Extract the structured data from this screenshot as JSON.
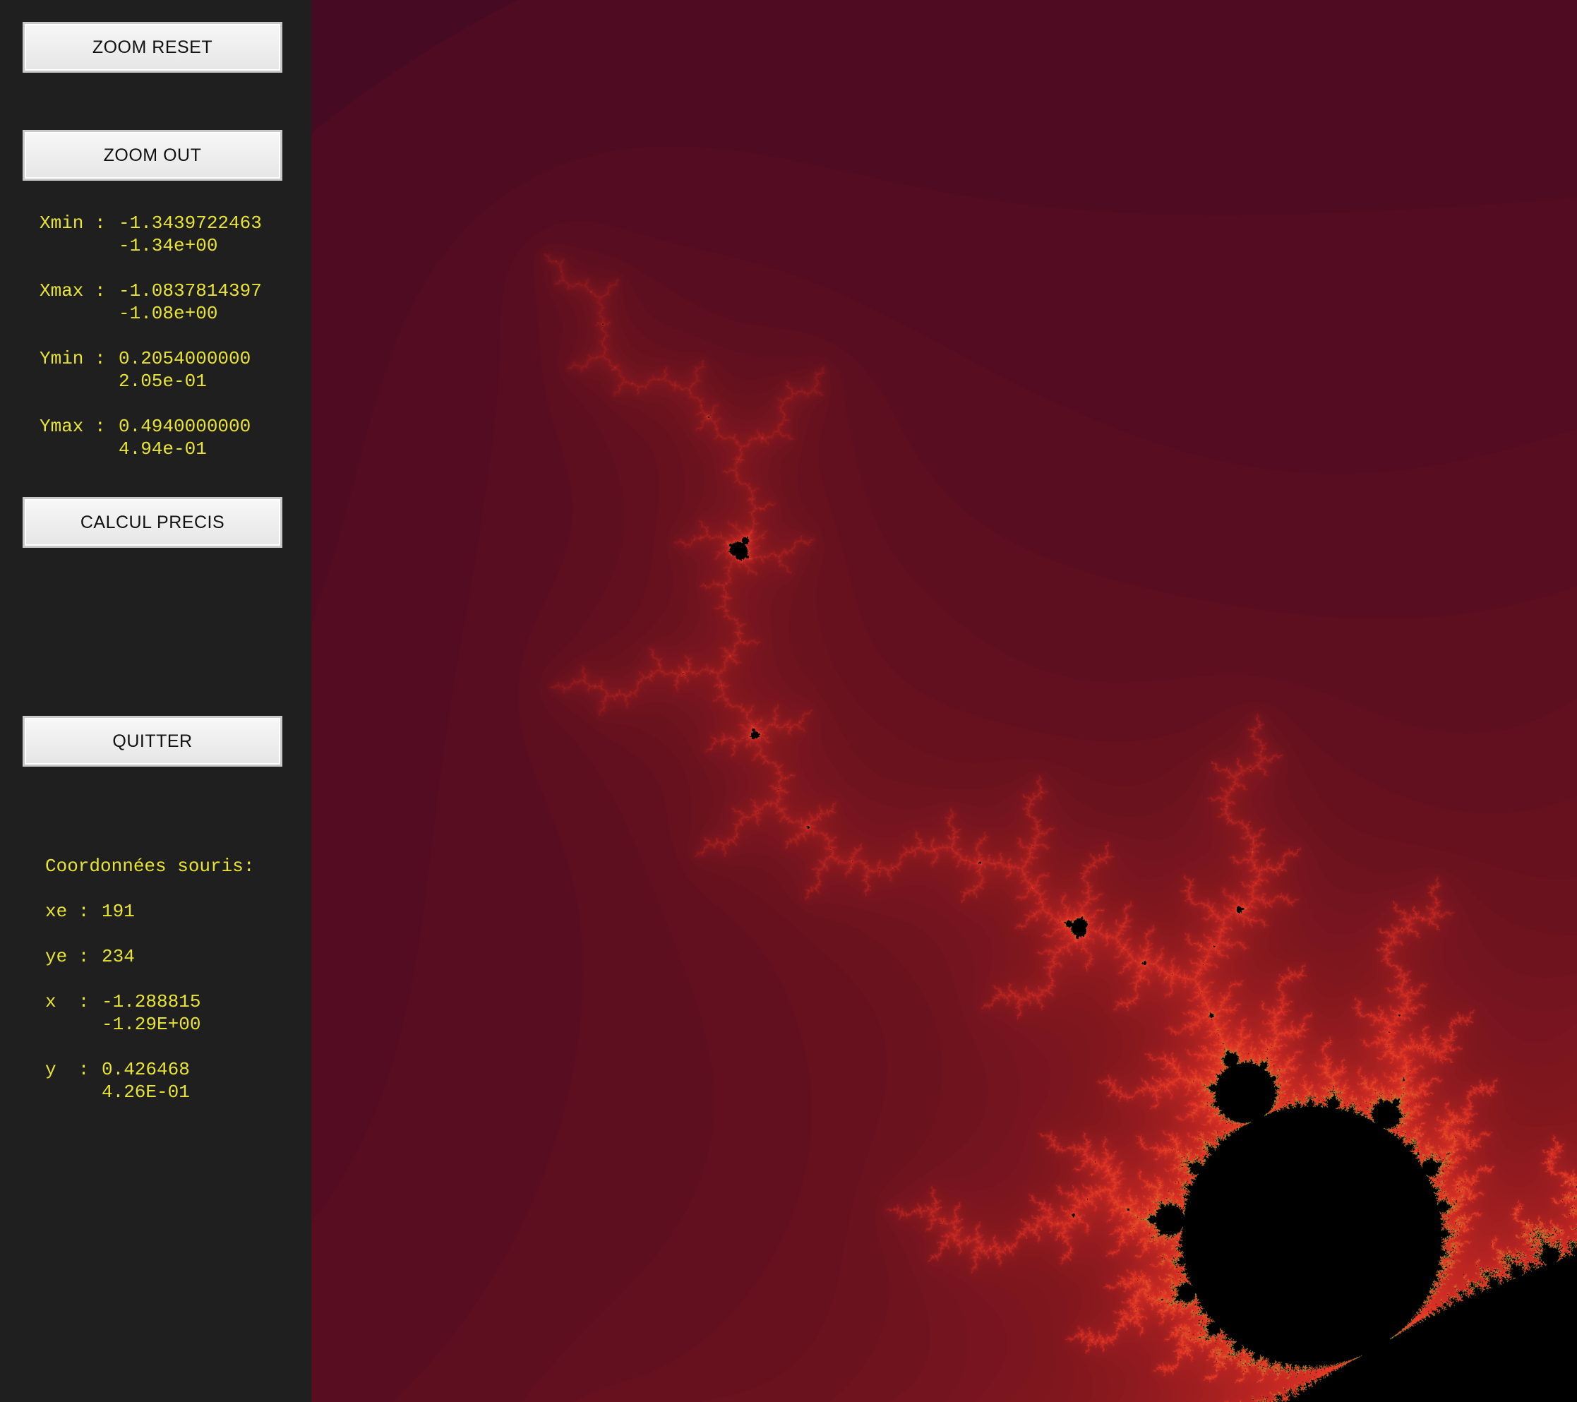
{
  "buttons": {
    "zoom_reset": "ZOOM RESET",
    "zoom_out": "ZOOM OUT",
    "calcul_precis": "CALCUL PRECIS",
    "quitter": "QUITTER"
  },
  "bounds": {
    "xmin": {
      "label": "Xmin :",
      "value": "-1.3439722463",
      "sci": "-1.34e+00"
    },
    "xmax": {
      "label": "Xmax :",
      "value": "-1.0837814397",
      "sci": "-1.08e+00"
    },
    "ymin": {
      "label": "Ymin :",
      "value": "0.2054000000",
      "sci": "2.05e-01"
    },
    "ymax": {
      "label": "Ymax :",
      "value": "0.4940000000",
      "sci": "4.94e-01"
    }
  },
  "mouse": {
    "title": "Coordonnées souris:",
    "xe": {
      "label": "xe :",
      "value": "191"
    },
    "ye": {
      "label": "ye :",
      "value": "234"
    },
    "x": {
      "label": "x  :",
      "value": "-1.288815",
      "sci": "-1.29E+00"
    },
    "y": {
      "label": "y  :",
      "value": "0.426468",
      "sci": "4.26E-01"
    }
  },
  "colors": {
    "sidebar_bg": "#1f1f1f",
    "text": "#e8e337",
    "set": "#000000"
  }
}
